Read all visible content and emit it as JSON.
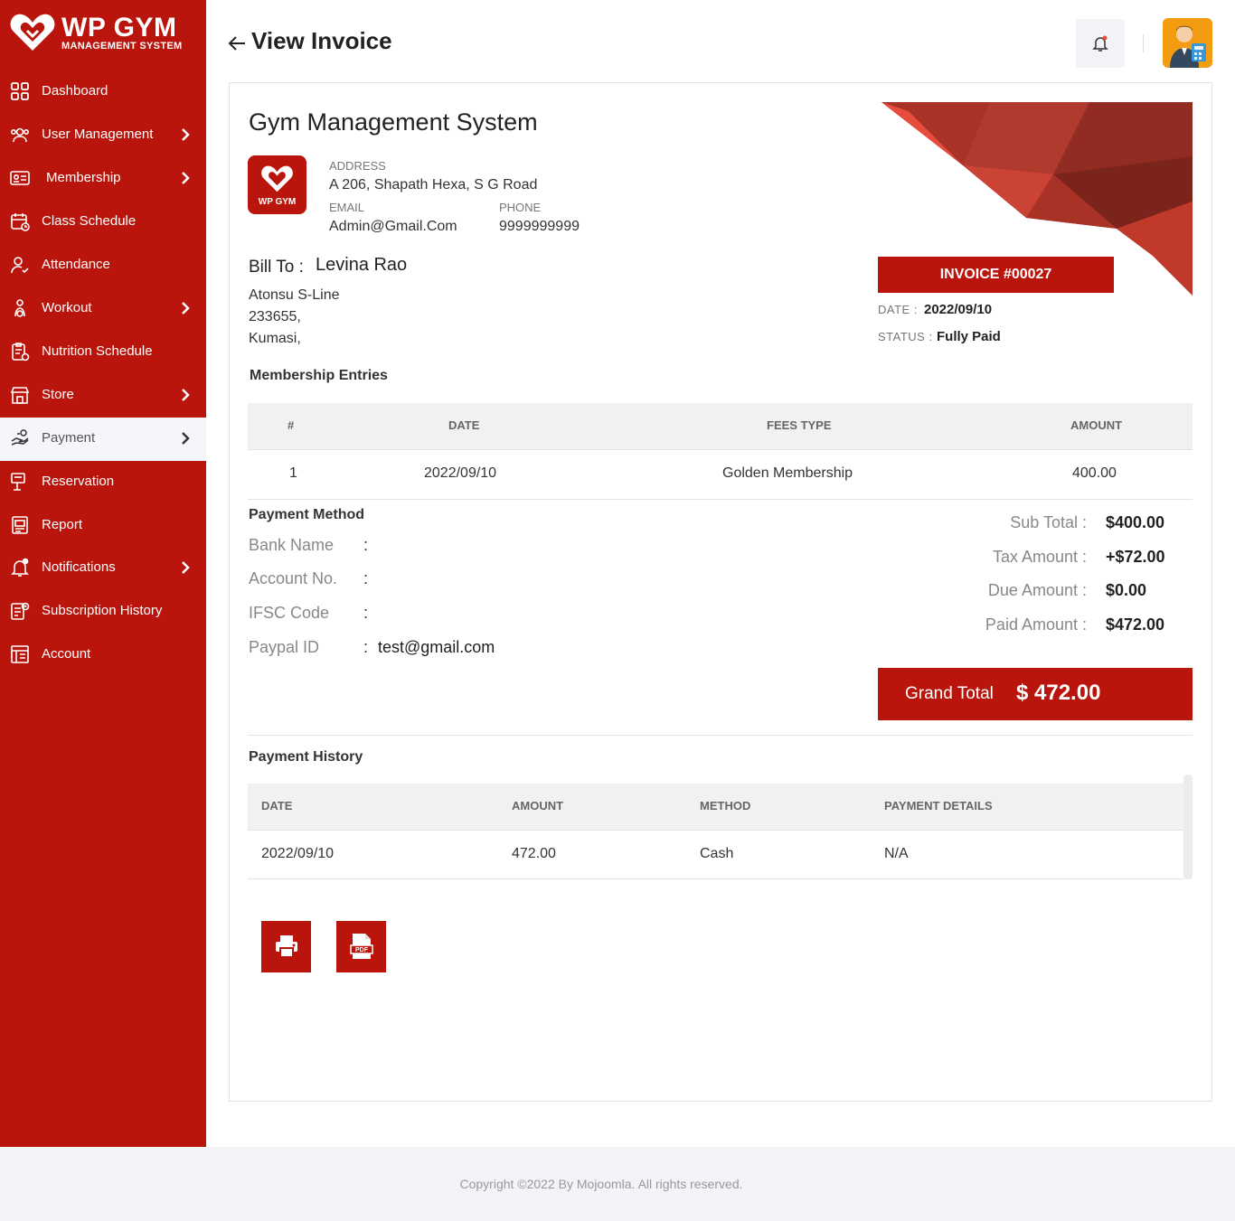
{
  "brand": {
    "title": "WP GYM",
    "subtitle": "MANAGEMENT SYSTEM",
    "color": "#b9150c"
  },
  "sidebar": {
    "items": [
      {
        "label": "Dashboard",
        "icon": "dashboard-icon",
        "has_submenu": false
      },
      {
        "label": "User Management",
        "icon": "users-icon",
        "has_submenu": true
      },
      {
        "label": "Membership",
        "icon": "membership-card-icon",
        "has_submenu": true
      },
      {
        "label": "Class Schedule",
        "icon": "calendar-icon",
        "has_submenu": false
      },
      {
        "label": "Attendance",
        "icon": "user-check-icon",
        "has_submenu": false
      },
      {
        "label": "Workout",
        "icon": "workout-icon",
        "has_submenu": true
      },
      {
        "label": "Nutrition Schedule",
        "icon": "clipboard-icon",
        "has_submenu": false
      },
      {
        "label": "Store",
        "icon": "store-icon",
        "has_submenu": true
      },
      {
        "label": "Payment",
        "icon": "payment-hand-icon",
        "has_submenu": true,
        "active": true
      },
      {
        "label": "Reservation",
        "icon": "reservation-icon",
        "has_submenu": false
      },
      {
        "label": "Report",
        "icon": "report-icon",
        "has_submenu": false
      },
      {
        "label": "Notifications",
        "icon": "bell-icon",
        "has_submenu": true
      },
      {
        "label": "Subscription History",
        "icon": "history-icon",
        "has_submenu": false
      },
      {
        "label": "Account",
        "icon": "account-icon",
        "has_submenu": false
      }
    ]
  },
  "header": {
    "title": "View Invoice"
  },
  "company": {
    "name": "Gym Management System",
    "logo_text": "WP GYM",
    "address_label": "ADDRESS",
    "address": "A 206, Shapath Hexa, S G Road",
    "email_label": "EMAIL",
    "email": "Admin@Gmail.Com",
    "phone_label": "PHONE",
    "phone": "9999999999"
  },
  "bill_to": {
    "label": "Bill To :",
    "name": "Levina Rao",
    "line1": "Atonsu S-Line",
    "line2": "233655,",
    "line3": "Kumasi,"
  },
  "invoice": {
    "badge": "INVOICE #00027",
    "date_label": "DATE :",
    "date": "2022/09/10",
    "status_label": "STATUS :",
    "status": "Fully Paid"
  },
  "entries": {
    "title": "Membership Entries",
    "headers": [
      "#",
      "DATE",
      "FEES TYPE",
      "AMOUNT"
    ],
    "rows": [
      [
        "1",
        "2022/09/10",
        "Golden Membership",
        "400.00"
      ]
    ]
  },
  "payment_method": {
    "title": "Payment Method",
    "bank_label": "Bank Name",
    "account_label": "Account No.",
    "ifsc_label": "IFSC Code",
    "paypal_label": "Paypal ID",
    "colon": ":",
    "paypal_value": "test@gmail.com"
  },
  "totals": {
    "sub_label": "Sub Total :",
    "sub": "$400.00",
    "tax_label": "Tax Amount :",
    "tax": "+$72.00",
    "due_label": "Due Amount :",
    "due": "$0.00",
    "paid_label": "Paid Amount :",
    "paid": "$472.00",
    "grand_label": "Grand Total",
    "grand": "$ 472.00"
  },
  "history": {
    "title": "Payment History",
    "headers": [
      "DATE",
      "AMOUNT",
      "METHOD",
      "PAYMENT DETAILS"
    ],
    "rows": [
      [
        "2022/09/10",
        "472.00",
        "Cash",
        "N/A"
      ]
    ]
  },
  "actions": {
    "print_icon": "print-icon",
    "pdf_icon": "pdf-icon"
  },
  "footer": {
    "text": "Copyright ©2022 By Mojoomla. All rights reserved."
  }
}
